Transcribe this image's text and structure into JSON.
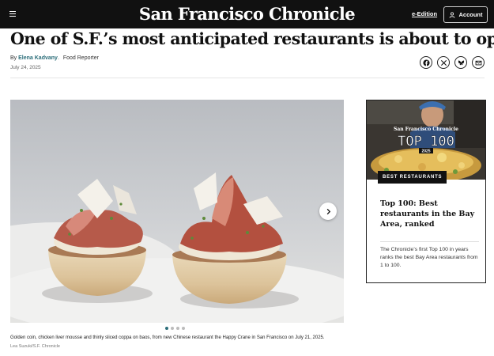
{
  "header": {
    "masthead": "San Francisco Chronicle",
    "eedition_label": "e-Edition",
    "account_label": "Account",
    "menu_icon": "hamburger-icon",
    "background": "#111111"
  },
  "article": {
    "headline": "One of S.F.’s most anticipated restaurants is about to open",
    "byline_prefix": "By",
    "author": "Elena Kadvany",
    "author_separator": ".",
    "role": "Food Reporter",
    "date": "July 24, 2025",
    "share_icons": [
      "facebook-icon",
      "x-icon",
      "bluesky-icon",
      "email-icon"
    ]
  },
  "gallery": {
    "caption": "Golden coin, chicken liver mousse and thinly sliced coppa on baos, from new Chinese restaurant the Happy Crane in San Francisco on July 21, 2025.",
    "credit": "Lea Suzuki/S.F. Chronicle",
    "slide_count": 4,
    "active_slide": 1,
    "next_icon": "chevron-right-icon"
  },
  "promo": {
    "image_masthead": "San Francisco Chronicle",
    "image_title": "TOP 100",
    "image_year": "2025",
    "badge": "BEST RESTAURANTS",
    "title": "Top 100: Best restaurants in the Bay Area, ranked",
    "description": "The Chronicle’s first Top 100 in years ranks the best Bay Area restaurants from 1 to 100."
  },
  "colors": {
    "accent": "#2c6e7a",
    "text": "#111111"
  }
}
